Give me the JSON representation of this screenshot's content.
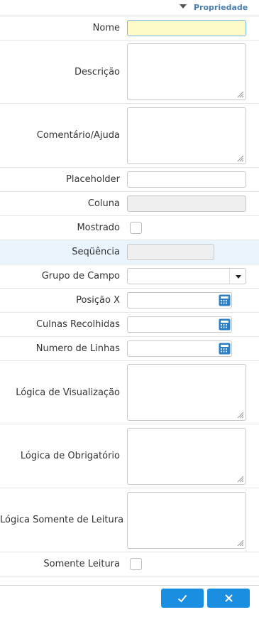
{
  "header": {
    "title": "Propriedade"
  },
  "fields": {
    "nome": {
      "label": "Nome",
      "value": ""
    },
    "descricao": {
      "label": "Descrição"
    },
    "comentario": {
      "label": "Comentário/Ajuda"
    },
    "placeholder": {
      "label": "Placeholder",
      "value": ""
    },
    "coluna": {
      "label": "Coluna",
      "value": ""
    },
    "mostrado": {
      "label": "Mostrado",
      "checked": false
    },
    "sequencia": {
      "label": "Seqüência",
      "value": ""
    },
    "grupo_campo": {
      "label": "Grupo de Campo",
      "value": ""
    },
    "posicao_x": {
      "label": "Posição X",
      "value": ""
    },
    "colunas_recolhidas": {
      "label": "Culnas Recolhidas",
      "value": ""
    },
    "numero_linhas": {
      "label": "Numero de Linhas",
      "value": ""
    },
    "logica_visualizacao": {
      "label": "Lógica de Visualização"
    },
    "logica_obrigatorio": {
      "label": "Lógica de Obrigatório"
    },
    "logica_somente_leitura": {
      "label": "Lógica Somente de Leitura"
    },
    "somente_leitura": {
      "label": "Somente Leitura",
      "checked": false
    }
  },
  "icons": {
    "collapse": "triangle-down-icon",
    "calendar": "calculator-icon",
    "ok": "check-icon",
    "cancel": "close-icon"
  },
  "colors": {
    "accent": "#1a8ee1",
    "header_text": "#4a7fb0",
    "active_field_bg": "#fdfbc8",
    "highlight_row": "#eaf4fd"
  }
}
